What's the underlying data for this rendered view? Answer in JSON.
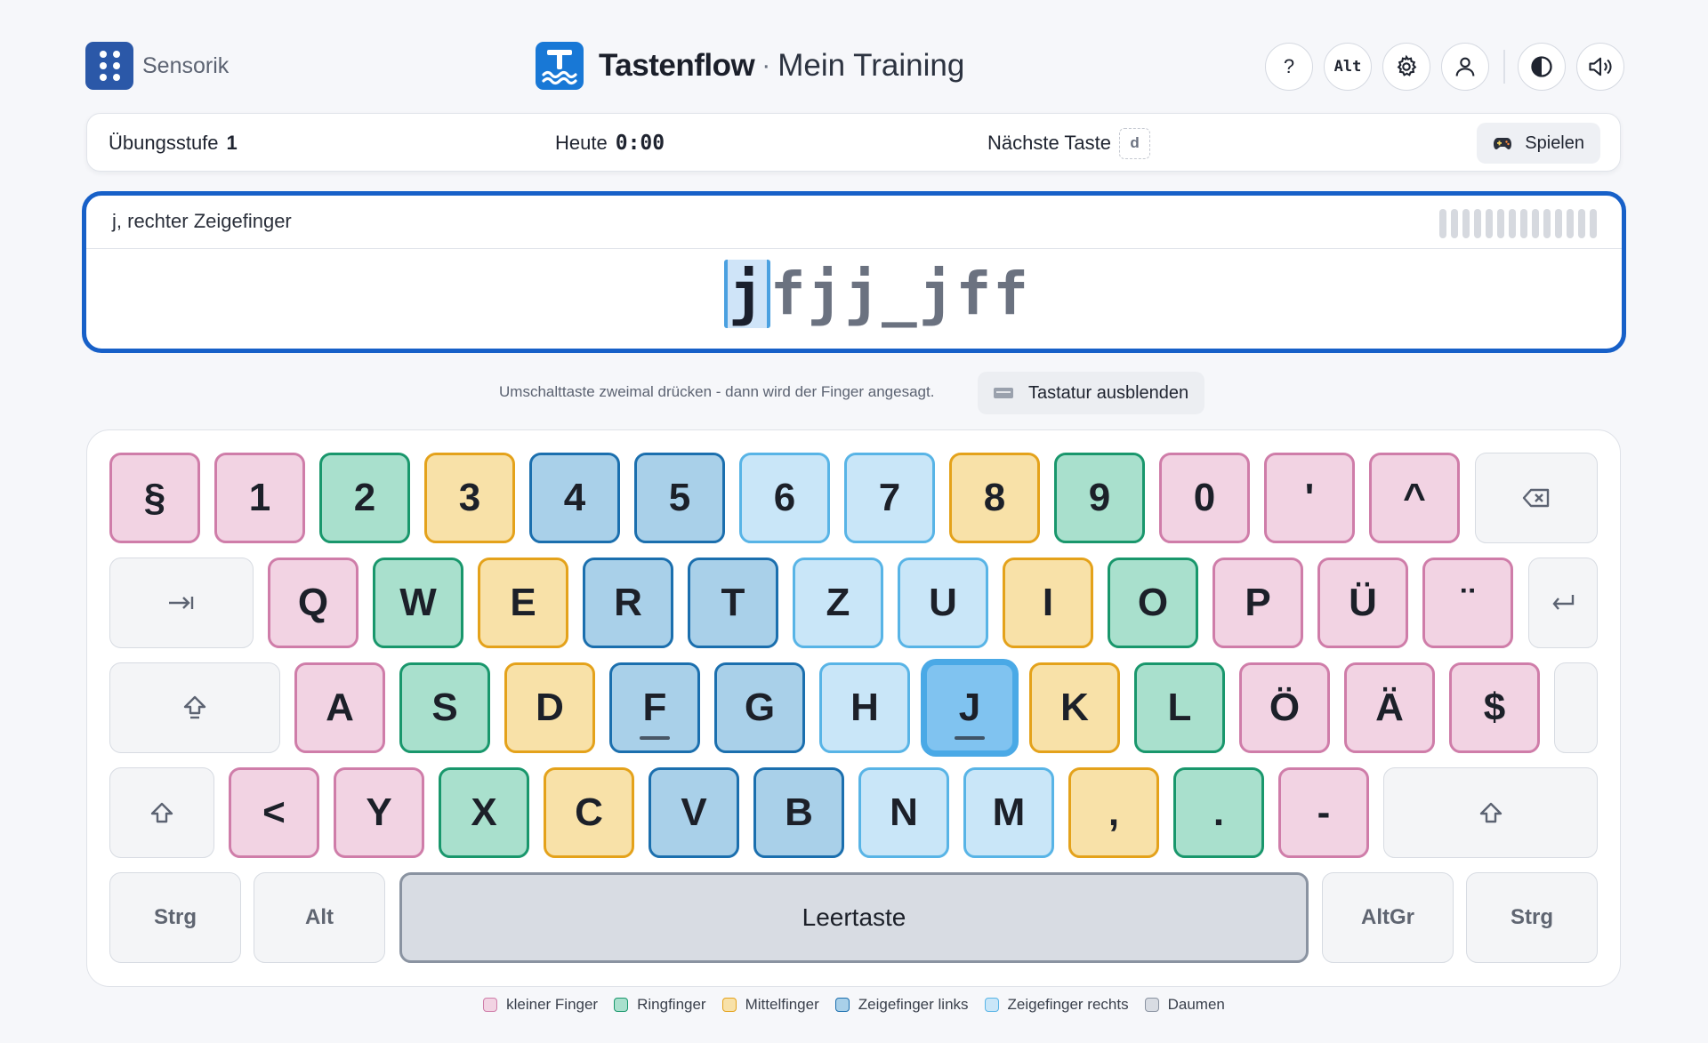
{
  "header": {
    "brand": "Sensorik",
    "app_name": "Tastenflow",
    "separator": "·",
    "app_subtitle": "Mein Training",
    "alt_button": "Alt",
    "help_button": "?"
  },
  "status": {
    "level_label": "Übungsstufe",
    "level_value": "1",
    "today_label": "Heute",
    "today_value": "0:00",
    "next_key_label": "Nächste Taste",
    "next_key_value": "d",
    "play_label": "Spielen"
  },
  "exercise": {
    "hint": "j, rechter Zeigefinger",
    "current_char": "j",
    "remaining_text_1": "fjj",
    "space_glyph": "_",
    "remaining_text_2": "jff",
    "progress_segments": 14
  },
  "helper": {
    "text": "Umschalttaste zweimal drücken - dann wird der Finger angesagt.",
    "hide_keyboard_label": "Tastatur ausblenden"
  },
  "keyboard": {
    "row1": [
      "§",
      "1",
      "2",
      "3",
      "4",
      "5",
      "6",
      "7",
      "8",
      "9",
      "0",
      "'",
      "^"
    ],
    "row2": [
      "Q",
      "W",
      "E",
      "R",
      "T",
      "Z",
      "U",
      "I",
      "O",
      "P",
      "Ü",
      "¨"
    ],
    "row3": [
      "A",
      "S",
      "D",
      "F",
      "G",
      "H",
      "J",
      "K",
      "L",
      "Ö",
      "Ä",
      "$"
    ],
    "row4": [
      "<",
      "Y",
      "X",
      "C",
      "V",
      "B",
      "N",
      "M",
      ",",
      ".",
      "-"
    ],
    "row5": {
      "ctrl_left": "Strg",
      "alt": "Alt",
      "space": "Leertaste",
      "altgr": "AltGr",
      "ctrl_right": "Strg"
    },
    "active_key": "J"
  },
  "legend": [
    {
      "label": "kleiner Finger",
      "fill": "#f2d3e3",
      "border": "#cf7da9"
    },
    {
      "label": "Ringfinger",
      "fill": "#a9e0cd",
      "border": "#19976c"
    },
    {
      "label": "Mittelfinger",
      "fill": "#f8e1a8",
      "border": "#e4a21b"
    },
    {
      "label": "Zeigefinger links",
      "fill": "#a9d0e9",
      "border": "#1b6fae"
    },
    {
      "label": "Zeigefinger rechts",
      "fill": "#c9e6f8",
      "border": "#58b4e6"
    },
    {
      "label": "Daumen",
      "fill": "#d8dce3",
      "border": "#8a93a1"
    }
  ],
  "colors": {
    "accent": "#1760c8",
    "app_logo": "#1878d6",
    "brand_logo": "#2b58a8"
  },
  "icons": {
    "brand": "grid-dots-icon",
    "app": "t-wave-logo-icon",
    "settings": "gear-icon",
    "profile": "user-icon",
    "contrast": "contrast-icon",
    "sound": "speaker-icon",
    "play": "gamepad-icon",
    "keyboard": "keyboard-icon",
    "backspace": "backspace-icon",
    "tab": "tab-icon",
    "enter": "enter-icon",
    "capslock": "capslock-icon",
    "shift": "shift-icon"
  }
}
